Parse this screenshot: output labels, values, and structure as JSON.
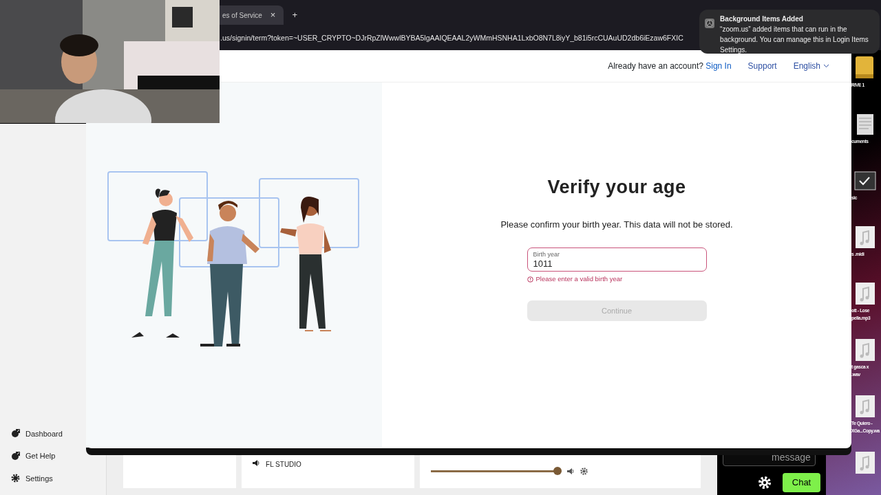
{
  "browser": {
    "tab": {
      "title": "es of Service",
      "close": "×",
      "selected": true
    },
    "new_tab": "+",
    "url": ".us/signin/term?token=~USER_CRYPTO~DJrRpZlWwwlBYBA5lgAAIQEAAL2yWMmHSNHA1LxbO8N7L8iyY_b81i5rcCUAuUD2db6iEzaw6FXIC"
  },
  "notification": {
    "title": "Background Items Added",
    "body": "“zoom.us” added items that can run in the background. You can manage this in Login Items Settings."
  },
  "page": {
    "header": {
      "prompt": "Already have an account?",
      "sign_in": "Sign In",
      "support": "Support",
      "language": "English"
    },
    "title": "Verify your age",
    "subtitle": "Please confirm your birth year. This data will not be stored.",
    "field": {
      "label": "Birth year",
      "value": "1011",
      "invalid": true
    },
    "error": "Please enter a valid birth year",
    "continue": {
      "label": "Continue",
      "disabled": true
    }
  },
  "sidebar": {
    "items": [
      {
        "label": "Dashboard",
        "kind": "dashboard"
      },
      {
        "label": "Get Help",
        "kind": "help"
      },
      {
        "label": "Settings",
        "kind": "settings"
      }
    ]
  },
  "audio": {
    "source": "FL STUDIO",
    "level": 0.97
  },
  "chat": {
    "placeholder": "message",
    "button": "Chat"
  },
  "desktop_icons": [
    {
      "kind": "drive",
      "label": [
        "RIVE 1"
      ]
    },
    {
      "kind": "document",
      "label": [
        "cuments"
      ]
    },
    {
      "kind": "folder",
      "label": [
        "sic"
      ]
    },
    {
      "kind": "audio",
      "label": [
        "s .midi"
      ]
    },
    {
      "kind": "audio",
      "label": [
        "ott - Lose",
        "pella.mp3"
      ]
    },
    {
      "kind": "audio",
      "label": [
        "t gasca x",
        ".wav"
      ]
    },
    {
      "kind": "audio",
      "label": [
        "Te Quiero -",
        "XGa...Copy.wa"
      ]
    },
    {
      "kind": "audio"
    }
  ]
}
